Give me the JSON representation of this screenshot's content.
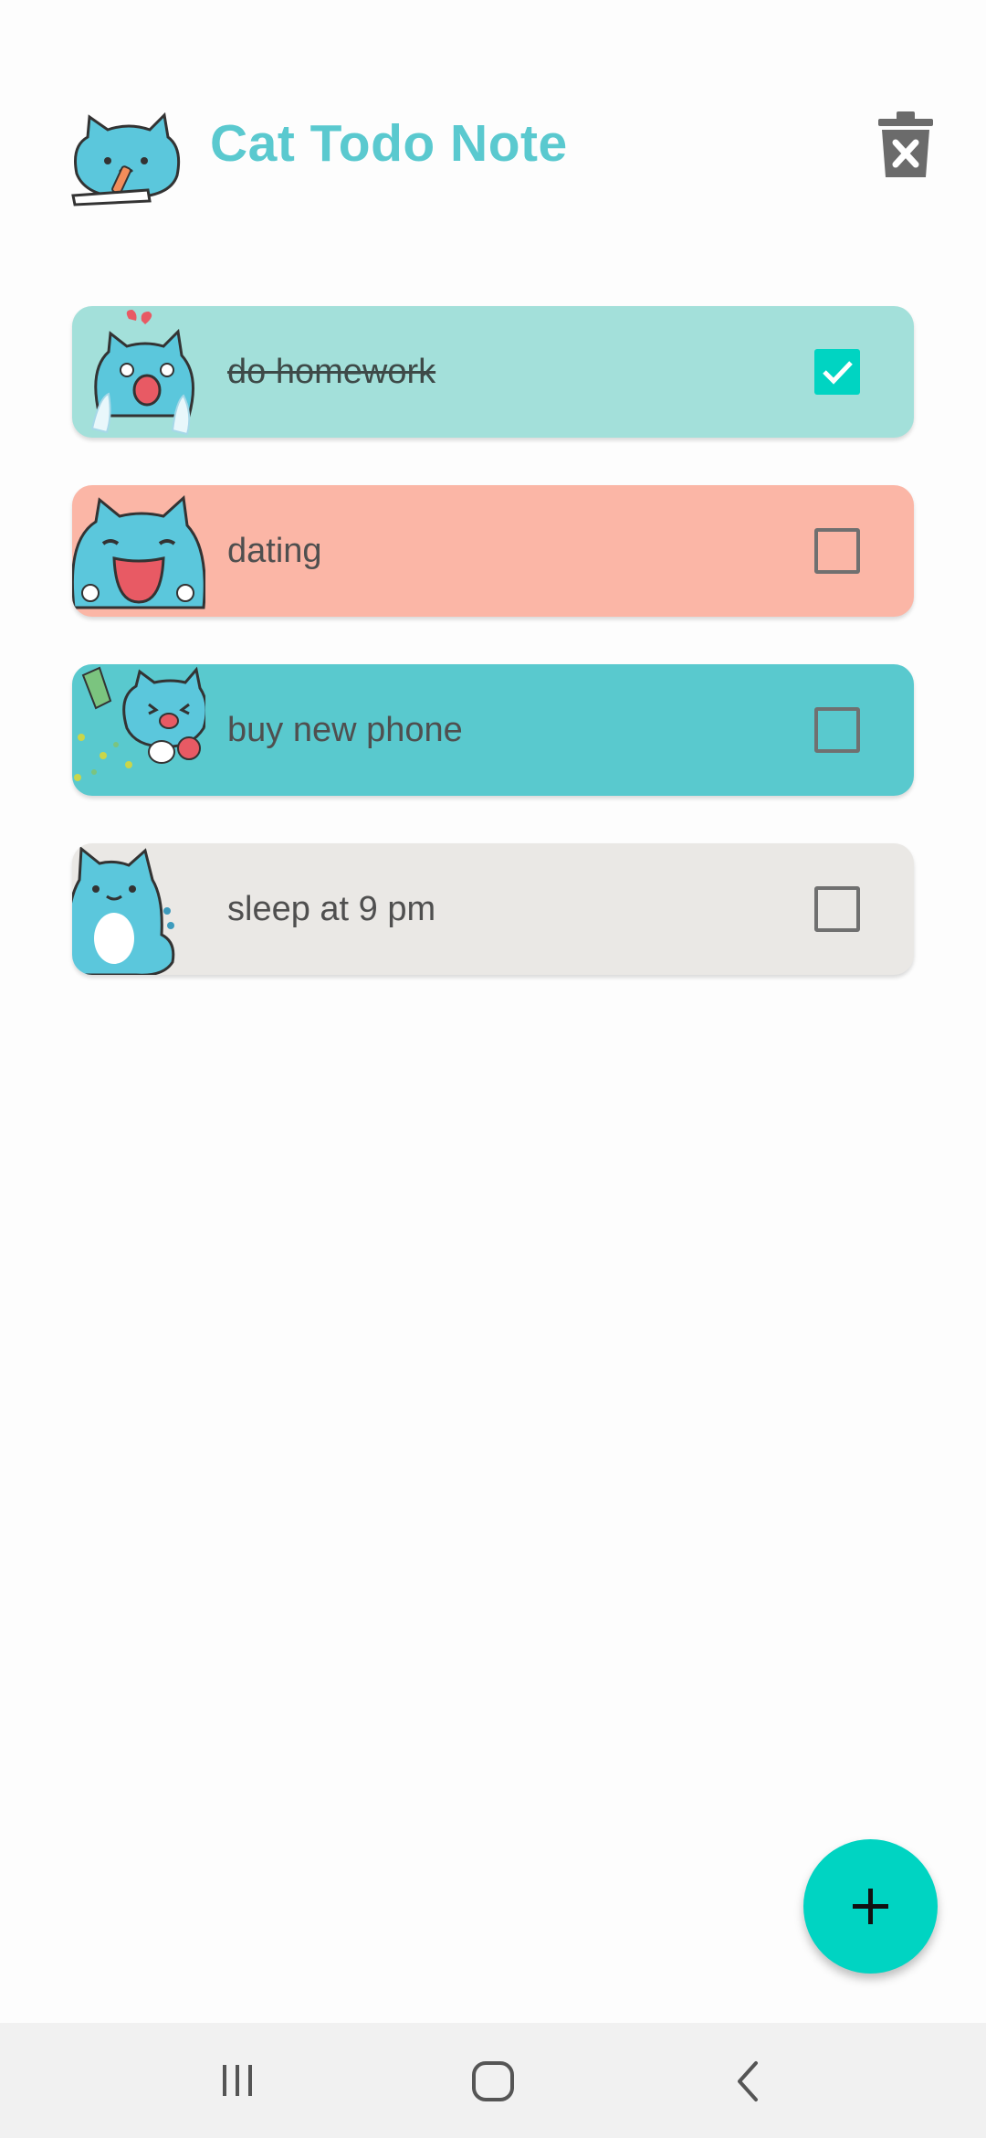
{
  "header": {
    "title": "Cat Todo Note",
    "logo_icon": "cat-writing-icon",
    "delete_icon": "trash-x-icon"
  },
  "colors": {
    "title": "#5ac9cf",
    "accent": "#00d4c2",
    "card_teal_light": "#a3e0da",
    "card_salmon": "#fbb6a6",
    "card_teal": "#59c9ce",
    "card_gray": "#eae8e5"
  },
  "todos": [
    {
      "label": "do homework",
      "done": true,
      "color": "#a3e0da",
      "icon": "crying-cat-icon"
    },
    {
      "label": "dating",
      "done": false,
      "color": "#fbb6a6",
      "icon": "happy-cat-icon"
    },
    {
      "label": "buy new phone",
      "done": false,
      "color": "#59c9ce",
      "icon": "cat-money-icon"
    },
    {
      "label": "sleep at 9 pm",
      "done": false,
      "color": "#eae8e5",
      "icon": "standing-cat-icon"
    }
  ],
  "fab": {
    "icon": "plus-icon"
  },
  "navbar": {
    "recents_icon": "recents-icon",
    "home_icon": "home-icon",
    "back_icon": "back-icon"
  }
}
